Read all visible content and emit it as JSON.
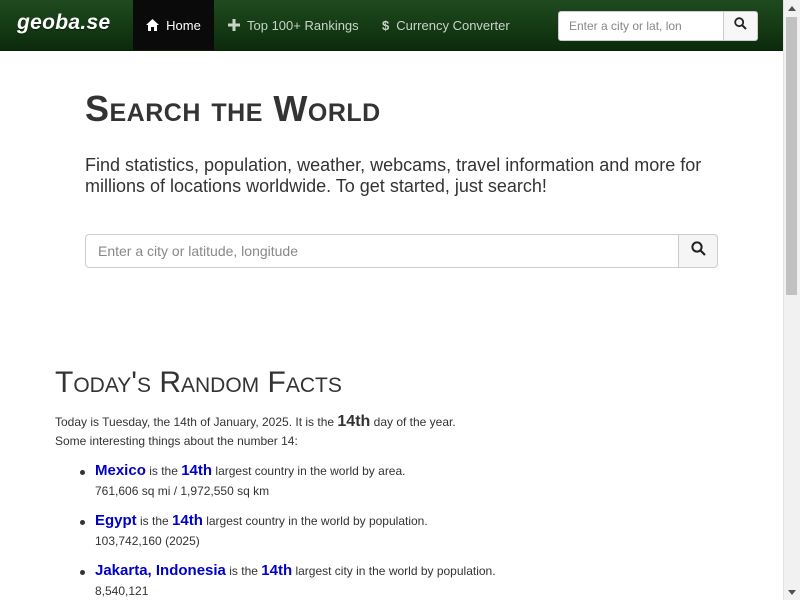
{
  "nav": {
    "brand": "geoba.se",
    "items": [
      {
        "label": "Home",
        "icon": "home-icon"
      },
      {
        "label": "Top 100+ Rankings",
        "icon": "plus-icon"
      },
      {
        "label": "Currency Converter",
        "icon": "dollar-icon"
      }
    ],
    "search_placeholder": "Enter a city or lat, lon"
  },
  "hero": {
    "title": "Search the World",
    "description": "Find statistics, population, weather, webcams, travel information and more for millions of locations worldwide. To get started, just search!",
    "search_placeholder": "Enter a city or latitude, longitude"
  },
  "facts": {
    "title": "Today's Random Facts",
    "intro_prefix": "Today is Tuesday, the 14th of January, 2025. It is the ",
    "intro_highlight": "14th",
    "intro_suffix": " day of the year.",
    "intro_line2": "Some interesting things about the number 14:",
    "items": [
      {
        "place": "Mexico",
        "connector": " is the ",
        "rank": "14th",
        "rest": " largest country in the world by area.",
        "detail": "761,606 sq mi / 1,972,550 sq km"
      },
      {
        "place": "Egypt",
        "connector": " is the ",
        "rank": "14th",
        "rest": " largest country in the world by population.",
        "detail": "103,742,160 (2025)"
      },
      {
        "place": "Jakarta, Indonesia",
        "connector": " is the ",
        "rank": "14th",
        "rest": " largest city in the world by population.",
        "detail": "8,540,121"
      }
    ]
  },
  "colors": {
    "navbar": "#143a14",
    "nav_active": "#0a0a0a",
    "link": "#0000cc",
    "text": "#333333"
  }
}
